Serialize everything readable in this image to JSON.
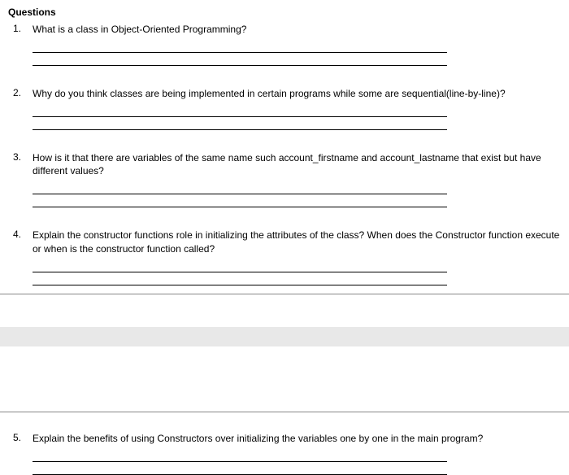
{
  "heading": "Questions",
  "questions": [
    {
      "number": "1.",
      "text": "What is a class in Object-Oriented Programming?"
    },
    {
      "number": "2.",
      "text": "Why do you think classes are being implemented in certain programs while some are sequential(line-by-line)?"
    },
    {
      "number": "3.",
      "text": "How is it that there are variables of the same name such account_firstname and account_lastname that exist but have different values?"
    },
    {
      "number": "4.",
      "text": "Explain the constructor functions role in initializing the attributes of the class? When does the Constructor function execute or when is the constructor function called?"
    },
    {
      "number": "5.",
      "text": "Explain the benefits of using Constructors over initializing the variables one by one in the main program?"
    }
  ]
}
